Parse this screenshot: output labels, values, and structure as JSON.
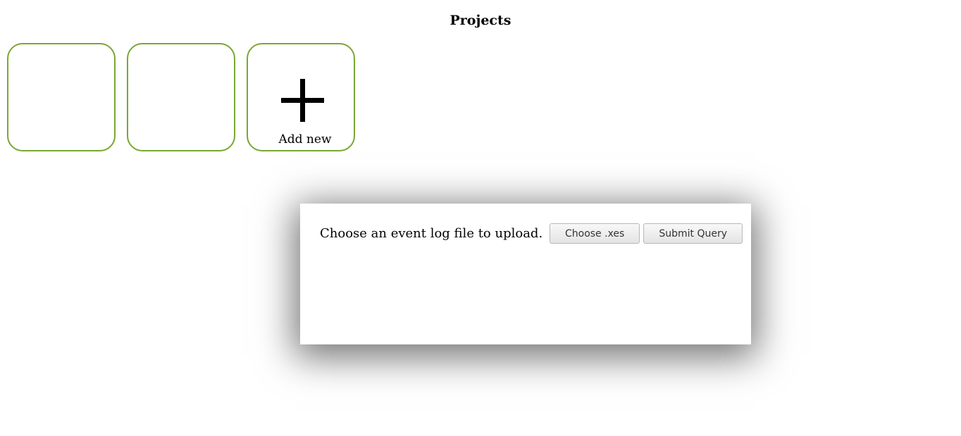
{
  "page": {
    "title": "Projects"
  },
  "projects": {
    "add_new_label": "Add new",
    "add_icon": "plus-icon",
    "card_border_color": "#78a832"
  },
  "upload_dialog": {
    "prompt": "Choose an event log file to upload.",
    "choose_button_label": "Choose .xes",
    "submit_button_label": "Submit Query"
  }
}
